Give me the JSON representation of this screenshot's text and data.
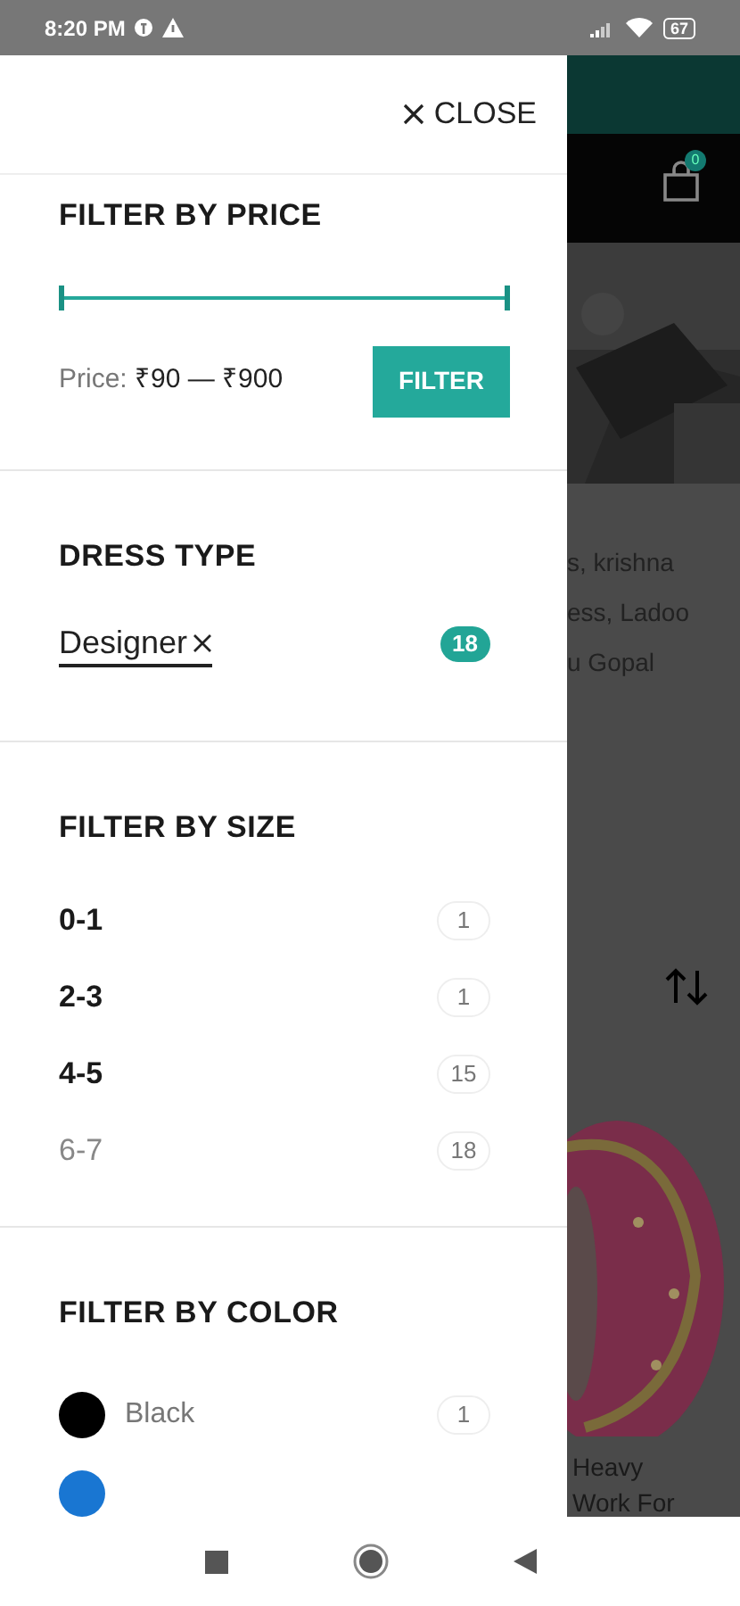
{
  "status_bar": {
    "time": "8:20 PM",
    "battery": "67"
  },
  "background_page": {
    "cart_count": "0",
    "description_lines": [
      "s, krishna",
      "ess, Ladoo",
      "u Gopal"
    ],
    "product_title_lines": [
      "Heavy",
      "Work For"
    ]
  },
  "drawer": {
    "close_label": "CLOSE",
    "price_filter": {
      "title": "FILTER BY PRICE",
      "level": 1,
      "price_label": "Price:",
      "price_range": "₹90 — ₹900",
      "button": "FILTER"
    },
    "dress_type": {
      "title": "DRESS TYPE",
      "chips": [
        {
          "label": "Designer",
          "count": "18"
        }
      ]
    },
    "size_filter": {
      "title": "FILTER BY SIZE",
      "items": [
        {
          "label": "0-1",
          "count": "1",
          "dimmed": false
        },
        {
          "label": "2-3",
          "count": "1",
          "dimmed": false
        },
        {
          "label": "4-5",
          "count": "15",
          "dimmed": false
        },
        {
          "label": "6-7",
          "count": "18",
          "dimmed": true
        }
      ]
    },
    "color_filter": {
      "title": "FILTER BY COLOR",
      "items": [
        {
          "label": "Black",
          "count": "1",
          "color": "#000000"
        },
        {
          "color": "#1976d2"
        }
      ]
    }
  }
}
